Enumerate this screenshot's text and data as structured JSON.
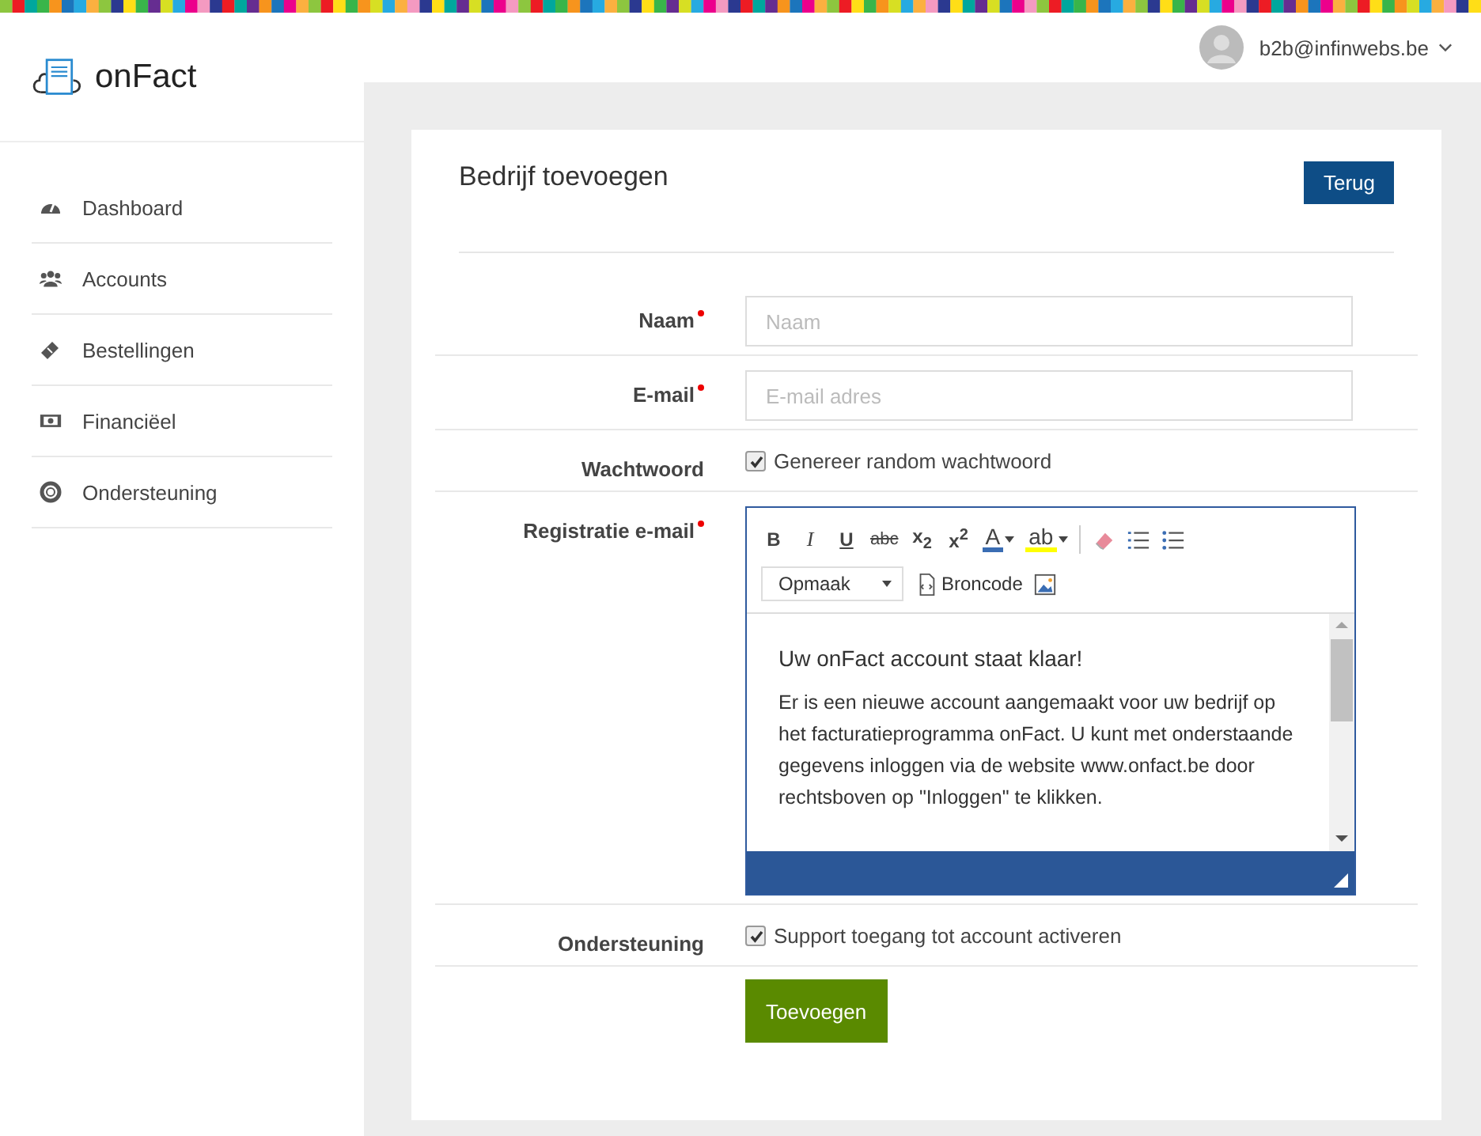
{
  "brand": {
    "name": "onFact"
  },
  "user": {
    "email": "b2b@infinwebs.be"
  },
  "sidebar": {
    "items": [
      {
        "label": "Dashboard",
        "selected": false
      },
      {
        "label": "Accounts",
        "selected": false
      },
      {
        "label": "Bestellingen",
        "selected": false
      },
      {
        "label": "Financiëel",
        "selected": false
      },
      {
        "label": "Ondersteuning",
        "selected": false
      }
    ]
  },
  "page": {
    "title": "Bedrijf toevoegen",
    "back_button": "Terug"
  },
  "form": {
    "rows": [
      {
        "kind": "input",
        "label": "Naam",
        "required": true,
        "placeholder": "Naam"
      },
      {
        "kind": "input",
        "label": "E-mail",
        "required": true,
        "placeholder": "E-mail adres"
      },
      {
        "kind": "checkbox",
        "label": "Wachtwoord",
        "required": false,
        "option": "Genereer random wachtwoord",
        "checked": true
      },
      {
        "kind": "editor",
        "label": "Registratie e-mail",
        "required": true
      },
      {
        "kind": "checkbox",
        "label": "Ondersteuning",
        "required": false,
        "option": "Support toegang tot account activeren",
        "checked": true
      }
    ],
    "submit": "Toevoegen"
  },
  "editor": {
    "toolbar": [
      {
        "kind": "text",
        "label": "B"
      },
      {
        "kind": "text",
        "label": "I"
      },
      {
        "kind": "text",
        "label": "U"
      },
      {
        "kind": "text",
        "label": "abc"
      },
      {
        "kind": "text",
        "label": "x$_{2}$"
      },
      {
        "kind": "text",
        "label": "x$^{2}$"
      },
      {
        "kind": "color",
        "label": "A",
        "color": "#3a6db3"
      },
      {
        "kind": "color",
        "label": "ab",
        "color": "#ffff00"
      },
      {
        "kind": "eraser"
      },
      {
        "kind": "numbered-list"
      },
      {
        "kind": "bulleted-list"
      }
    ],
    "format_select": "Opmaak",
    "source_button": "Broncode",
    "heading": "Uw onFact account staat klaar!",
    "body": "Er is een nieuwe account aangemaakt voor uw bedrijf op het facturatieprogramma onFact. U kunt met onderstaande gegevens inloggen via de website www.onfact.be door rechtsboven op \"Inloggen\" te klikken."
  }
}
